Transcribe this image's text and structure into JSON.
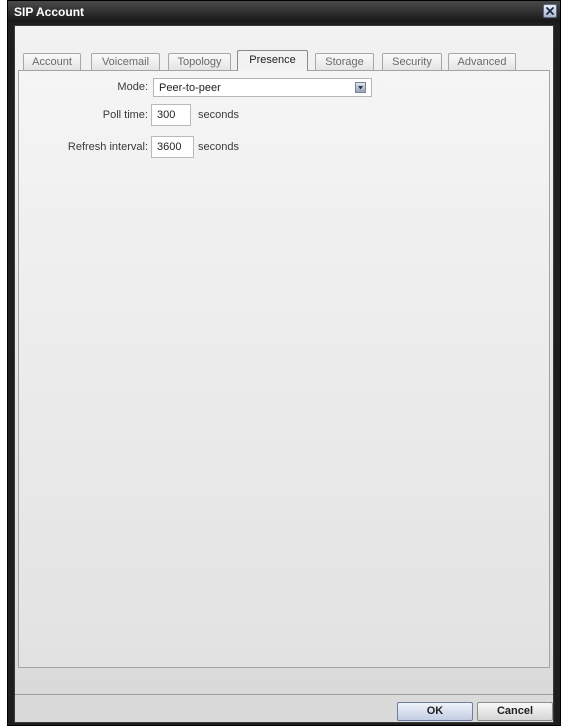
{
  "window": {
    "title": "SIP Account",
    "close_icon": "close-icon"
  },
  "tabs": [
    {
      "label": "Account",
      "active": false
    },
    {
      "label": "Voicemail",
      "active": false
    },
    {
      "label": "Topology",
      "active": false
    },
    {
      "label": "Presence",
      "active": true
    },
    {
      "label": "Storage",
      "active": false
    },
    {
      "label": "Security",
      "active": false
    },
    {
      "label": "Advanced",
      "active": false
    }
  ],
  "presence": {
    "mode_label": "Mode:",
    "mode_value": "Peer-to-peer",
    "poll_time_label": "Poll time:",
    "poll_time_value": "300",
    "poll_time_unit": "seconds",
    "refresh_interval_label": "Refresh interval:",
    "refresh_interval_value": "3600",
    "refresh_interval_unit": "seconds"
  },
  "buttons": {
    "ok_label": "OK",
    "cancel_label": "Cancel"
  }
}
